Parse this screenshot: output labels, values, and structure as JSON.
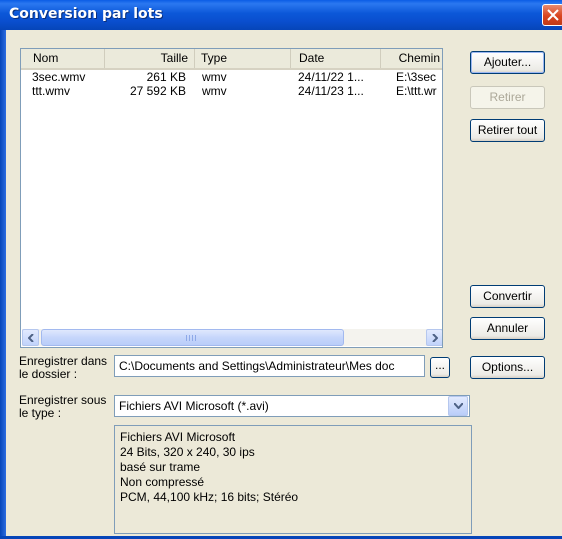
{
  "window": {
    "title": "Conversion par lots"
  },
  "file_list": {
    "columns": [
      {
        "label": "Nom"
      },
      {
        "label": "Taille"
      },
      {
        "label": "Type"
      },
      {
        "label": "Date"
      },
      {
        "label": "Chemin"
      }
    ],
    "rows": [
      {
        "name": "3sec.wmv",
        "size": "261 KB",
        "type": "wmv",
        "date": "24/11/22 1...",
        "path": "E:\\3sec"
      },
      {
        "name": "ttt.wmv",
        "size": "27 592 KB",
        "type": "wmv",
        "date": "24/11/23 1...",
        "path": "E:\\ttt.wr"
      }
    ],
    "scroll_thumb_grip": "III"
  },
  "buttons": {
    "add": "Ajouter...",
    "remove": "Retirer",
    "remove_all": "Retirer tout",
    "convert": "Convertir",
    "cancel": "Annuler",
    "options": "Options...",
    "browse": "..."
  },
  "save_folder": {
    "label_line1": "Enregistrer dans",
    "label_line2": "le dossier :",
    "value": "C:\\Documents and Settings\\Administrateur\\Mes doc"
  },
  "save_type": {
    "label_line1": "Enregistrer sous",
    "label_line2": "le type :",
    "selected": "Fichiers AVI Microsoft (*.avi)"
  },
  "format_info": [
    "Fichiers AVI Microsoft",
    "24 Bits, 320 x 240, 30 ips",
    "basé sur trame",
    "Non compressé",
    "PCM, 44,100 kHz; 16 bits; Stéréo"
  ],
  "colors": {
    "titlebar": "#0a5ce6",
    "close_button": "#d9451f",
    "dialog_bg": "#ece9d8"
  }
}
